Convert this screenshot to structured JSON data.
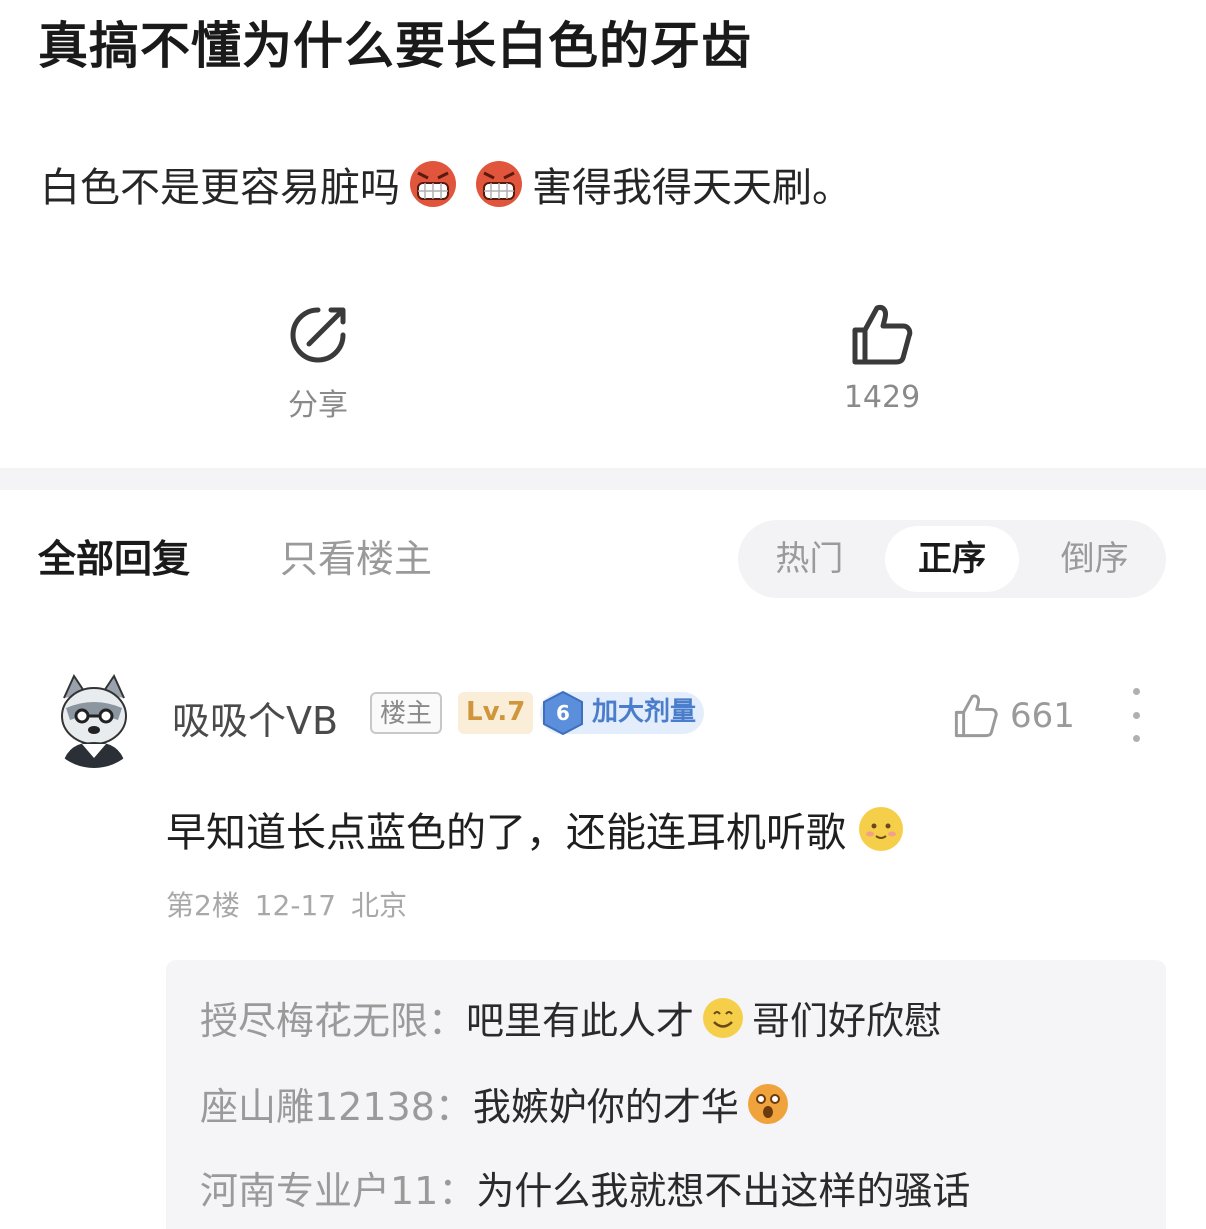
{
  "post": {
    "title": "真搞不懂为什么要长白色的牙齿",
    "body_before": "白色不是更容易脏吗",
    "body_after": "害得我得天天刷。",
    "body_emojis": [
      "angry-grimace-emoji",
      "angry-grimace-emoji"
    ]
  },
  "actions": {
    "share_label": "分享",
    "share_icon": "share-icon",
    "like_count": "1429",
    "like_icon": "thumbs-up-icon"
  },
  "filters": {
    "all_replies": "全部回复",
    "op_only": "只看楼主",
    "sort": [
      "热门",
      "正序",
      "倒序"
    ],
    "active_sort": "正序"
  },
  "reply": {
    "username": "吸吸个VB",
    "op_badge": "楼主",
    "level_badge": "Lv.7",
    "fan_level": "6",
    "fan_badge": "加大剂量",
    "likes": "661",
    "text": "早知道长点蓝色的了，还能连耳机听歌",
    "text_emoji": "blush-smile-emoji",
    "floor": "第2楼",
    "date": "12-17",
    "location": "北京",
    "subreplies": [
      {
        "name": "授尽梅花无限：",
        "text_before": "吧里有此人才",
        "emoji": "smile-emoji",
        "text_after": "哥们好欣慰"
      },
      {
        "name": "座山雕12138：",
        "text_before": "我嫉妒你的才华",
        "emoji": "surprised-emoji",
        "text_after": ""
      },
      {
        "name": "河南专业户11：",
        "text_before": "为什么我就想不出这样的骚话",
        "emoji": "",
        "text_after": ""
      }
    ]
  },
  "colors": {
    "accent_blue": "#4a7dcb",
    "level_gold": "#d0963e",
    "muted_gray": "#9a9a9a",
    "emoji_red": "#e0553b",
    "emoji_yellow": "#f6cf4a"
  }
}
